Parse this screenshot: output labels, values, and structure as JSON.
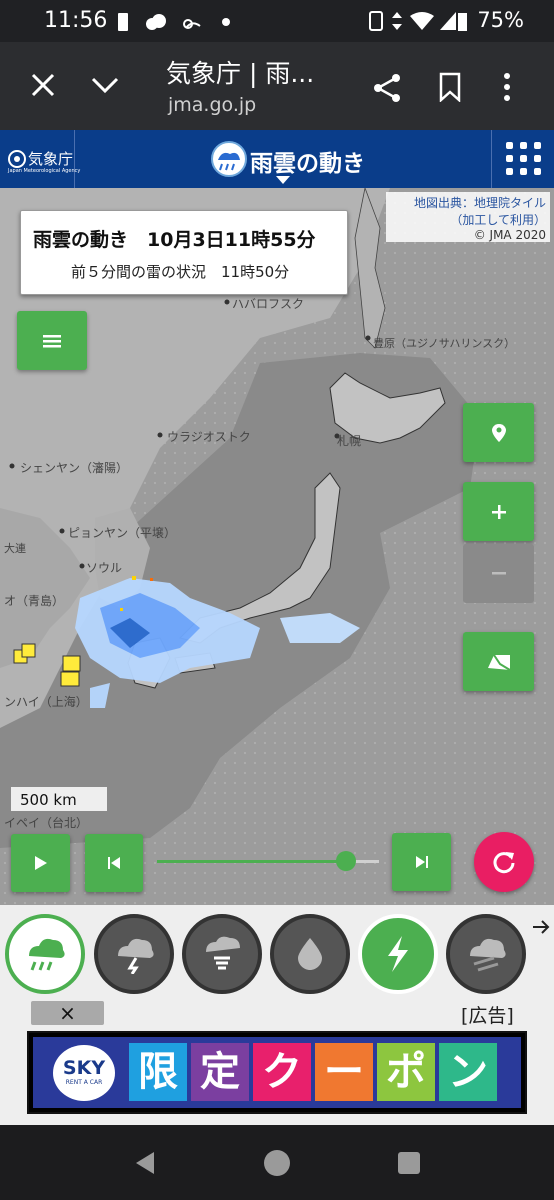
{
  "status_bar": {
    "time": "11:56",
    "battery": "75%"
  },
  "browser": {
    "page_title": "気象庁 | 雨...",
    "url": "jma.go.jp"
  },
  "jma_header": {
    "logo_text": "気象庁",
    "logo_subtext": "Japan Meteorological Agency",
    "title": "雨雲の動き"
  },
  "map": {
    "attribution_line1": "地図出典：地理院タイル",
    "attribution_line2": "（加工して利用）",
    "attribution_line3": "© JMA 2020",
    "info_title": "雨雲の動き　10月3日11時55分",
    "info_subtitle": "前５分間の雷の状況　11時50分",
    "scale_label": "500 km",
    "place_names": {
      "khabarovsk": "ハバロフスク",
      "yuzhno": "豊原（ユジノサハリンスク）",
      "vladivostok": "ウラジオストク",
      "shenyang": "シェンヤン（瀋陽）",
      "pyongyang": "ピョンヤン（平壌）",
      "seoul": "ソウル",
      "sapporo": "札幌",
      "qingdao": "オ（青島）",
      "taipei": "イペイ（台北）",
      "shanghai": "ンハイ（上海）",
      "dalian": "大連"
    },
    "timeline_progress": 0.85
  },
  "toolbar": {
    "ad_close": "×",
    "ad_label": "[広告]",
    "ad_brand": "SKY",
    "ad_brand_sub": "RENT A CAR",
    "ad_chars": [
      "限",
      "定",
      "ク",
      "ー",
      "ポ",
      "ン"
    ],
    "ad_colors": [
      "#1fa0e0",
      "#7b3fa0",
      "#e8206c",
      "#f07830",
      "#8dc63f",
      "#2eb88a"
    ]
  },
  "colors": {
    "jma_blue": "#0a3d8a",
    "green_button": "#4caf50",
    "refresh_pink": "#e91e63"
  }
}
